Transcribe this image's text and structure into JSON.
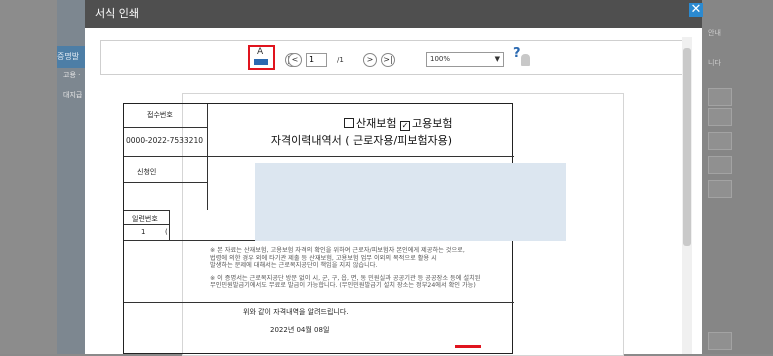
{
  "dialog": {
    "title": "서식 인쇄",
    "close_glyph": "✕"
  },
  "background": {
    "sidebar": {
      "active_label": "증명발",
      "item1": "고용 ·",
      "item2": "대지급"
    },
    "right": {
      "label1": "안내",
      "label2": "니다"
    }
  },
  "toolbar": {
    "print_glyph": "A",
    "first_page": "|<",
    "prev_page": "<",
    "page_input": "1",
    "page_total": "/1",
    "next_page": ">",
    "last_page": ">|",
    "zoom_value": "100%",
    "help_glyph": "?"
  },
  "document": {
    "receipt_label": "접수번호",
    "receipt_number": "0000-2022-7533210",
    "insurance_line": {
      "industrial_box": "",
      "industrial": "산재보험",
      "employment_box": "✓",
      "employment": "고용보험"
    },
    "title": "자격이력내역서 ( 근로자용/피보험자용)",
    "applicant_label": "신청인",
    "serial_label": "일련번호",
    "serial_value": "1",
    "row_partial": "(",
    "note1_line1": "※ 본 자료는 산재보험, 고용보험 자격의 확인을 위하여 근로자/피보험자 본인에게 제공하는 것으로,",
    "note1_line2": "   법령에 의한 경우 외에 타기관 제출 등 산재보험, 고용보험 업무 이외의 목적으로 활용 시",
    "note1_line3": "   발생하는 문제에 대해서는 근로복지공단이 책임을 지지 않습니다.",
    "note2_line1": "※ 이 증명서는 근로복지공단 방문 없이 시, 군, 구, 읍, 면, 동 민원실과 공공기관 등 공공장소 등에 설치된",
    "note2_line2": "   무인민원발급기에서도 무료로 발급이 가능합니다. (무인민원발급기 설치 장소는 정부24에서 확인 가능)",
    "confirm_text": "위와 같이 자격내역을 알려드립니다.",
    "date": "2022년 04월 08일"
  }
}
